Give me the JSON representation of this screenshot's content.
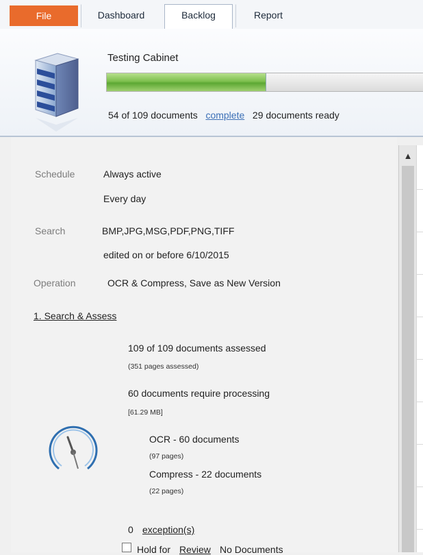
{
  "tabs": {
    "file": "File",
    "dashboard": "Dashboard",
    "backlog": "Backlog",
    "report": "Report"
  },
  "header": {
    "title": "Testing Cabinet",
    "progress": 0.495,
    "documents_complete": "54 of 109 documents",
    "complete_link": "complete",
    "documents_ready": "29 documents ready"
  },
  "details": {
    "schedule_label": "Schedule",
    "schedule_line1": "Always active",
    "schedule_line2": "Every day",
    "search_label": "Search",
    "search_line1": "BMP,JPG,MSG,PDF,PNG,TIFF",
    "search_line2": "edited on or before 6/10/2015",
    "operation_label": "Operation",
    "operation_value": "OCR & Compress, Save as New Version"
  },
  "assess": {
    "section_link": "1. Search & Assess",
    "assessed": "109 of 109 documents assessed",
    "pages_assessed": "(351 pages assessed)",
    "require_processing": "60 documents require processing",
    "size": "[61.29 MB]",
    "ocr": "OCR - 60 documents",
    "ocr_pages": "(97 pages)",
    "compress": "Compress - 22 documents",
    "compress_pages": "(22 pages)",
    "exceptions_count": "0",
    "exceptions_link": "exception(s)",
    "hold_label": "Hold for",
    "review_link": "Review",
    "no_documents": "No Documents"
  },
  "icons": {
    "cabinet": "file-cabinet-icon",
    "gauge": "gauge-icon",
    "scroll_up": "chevron-up-icon"
  },
  "colors": {
    "file_tab": "#e96b2c",
    "link": "#3b6fb6",
    "progress_fill": "#6fb443"
  }
}
